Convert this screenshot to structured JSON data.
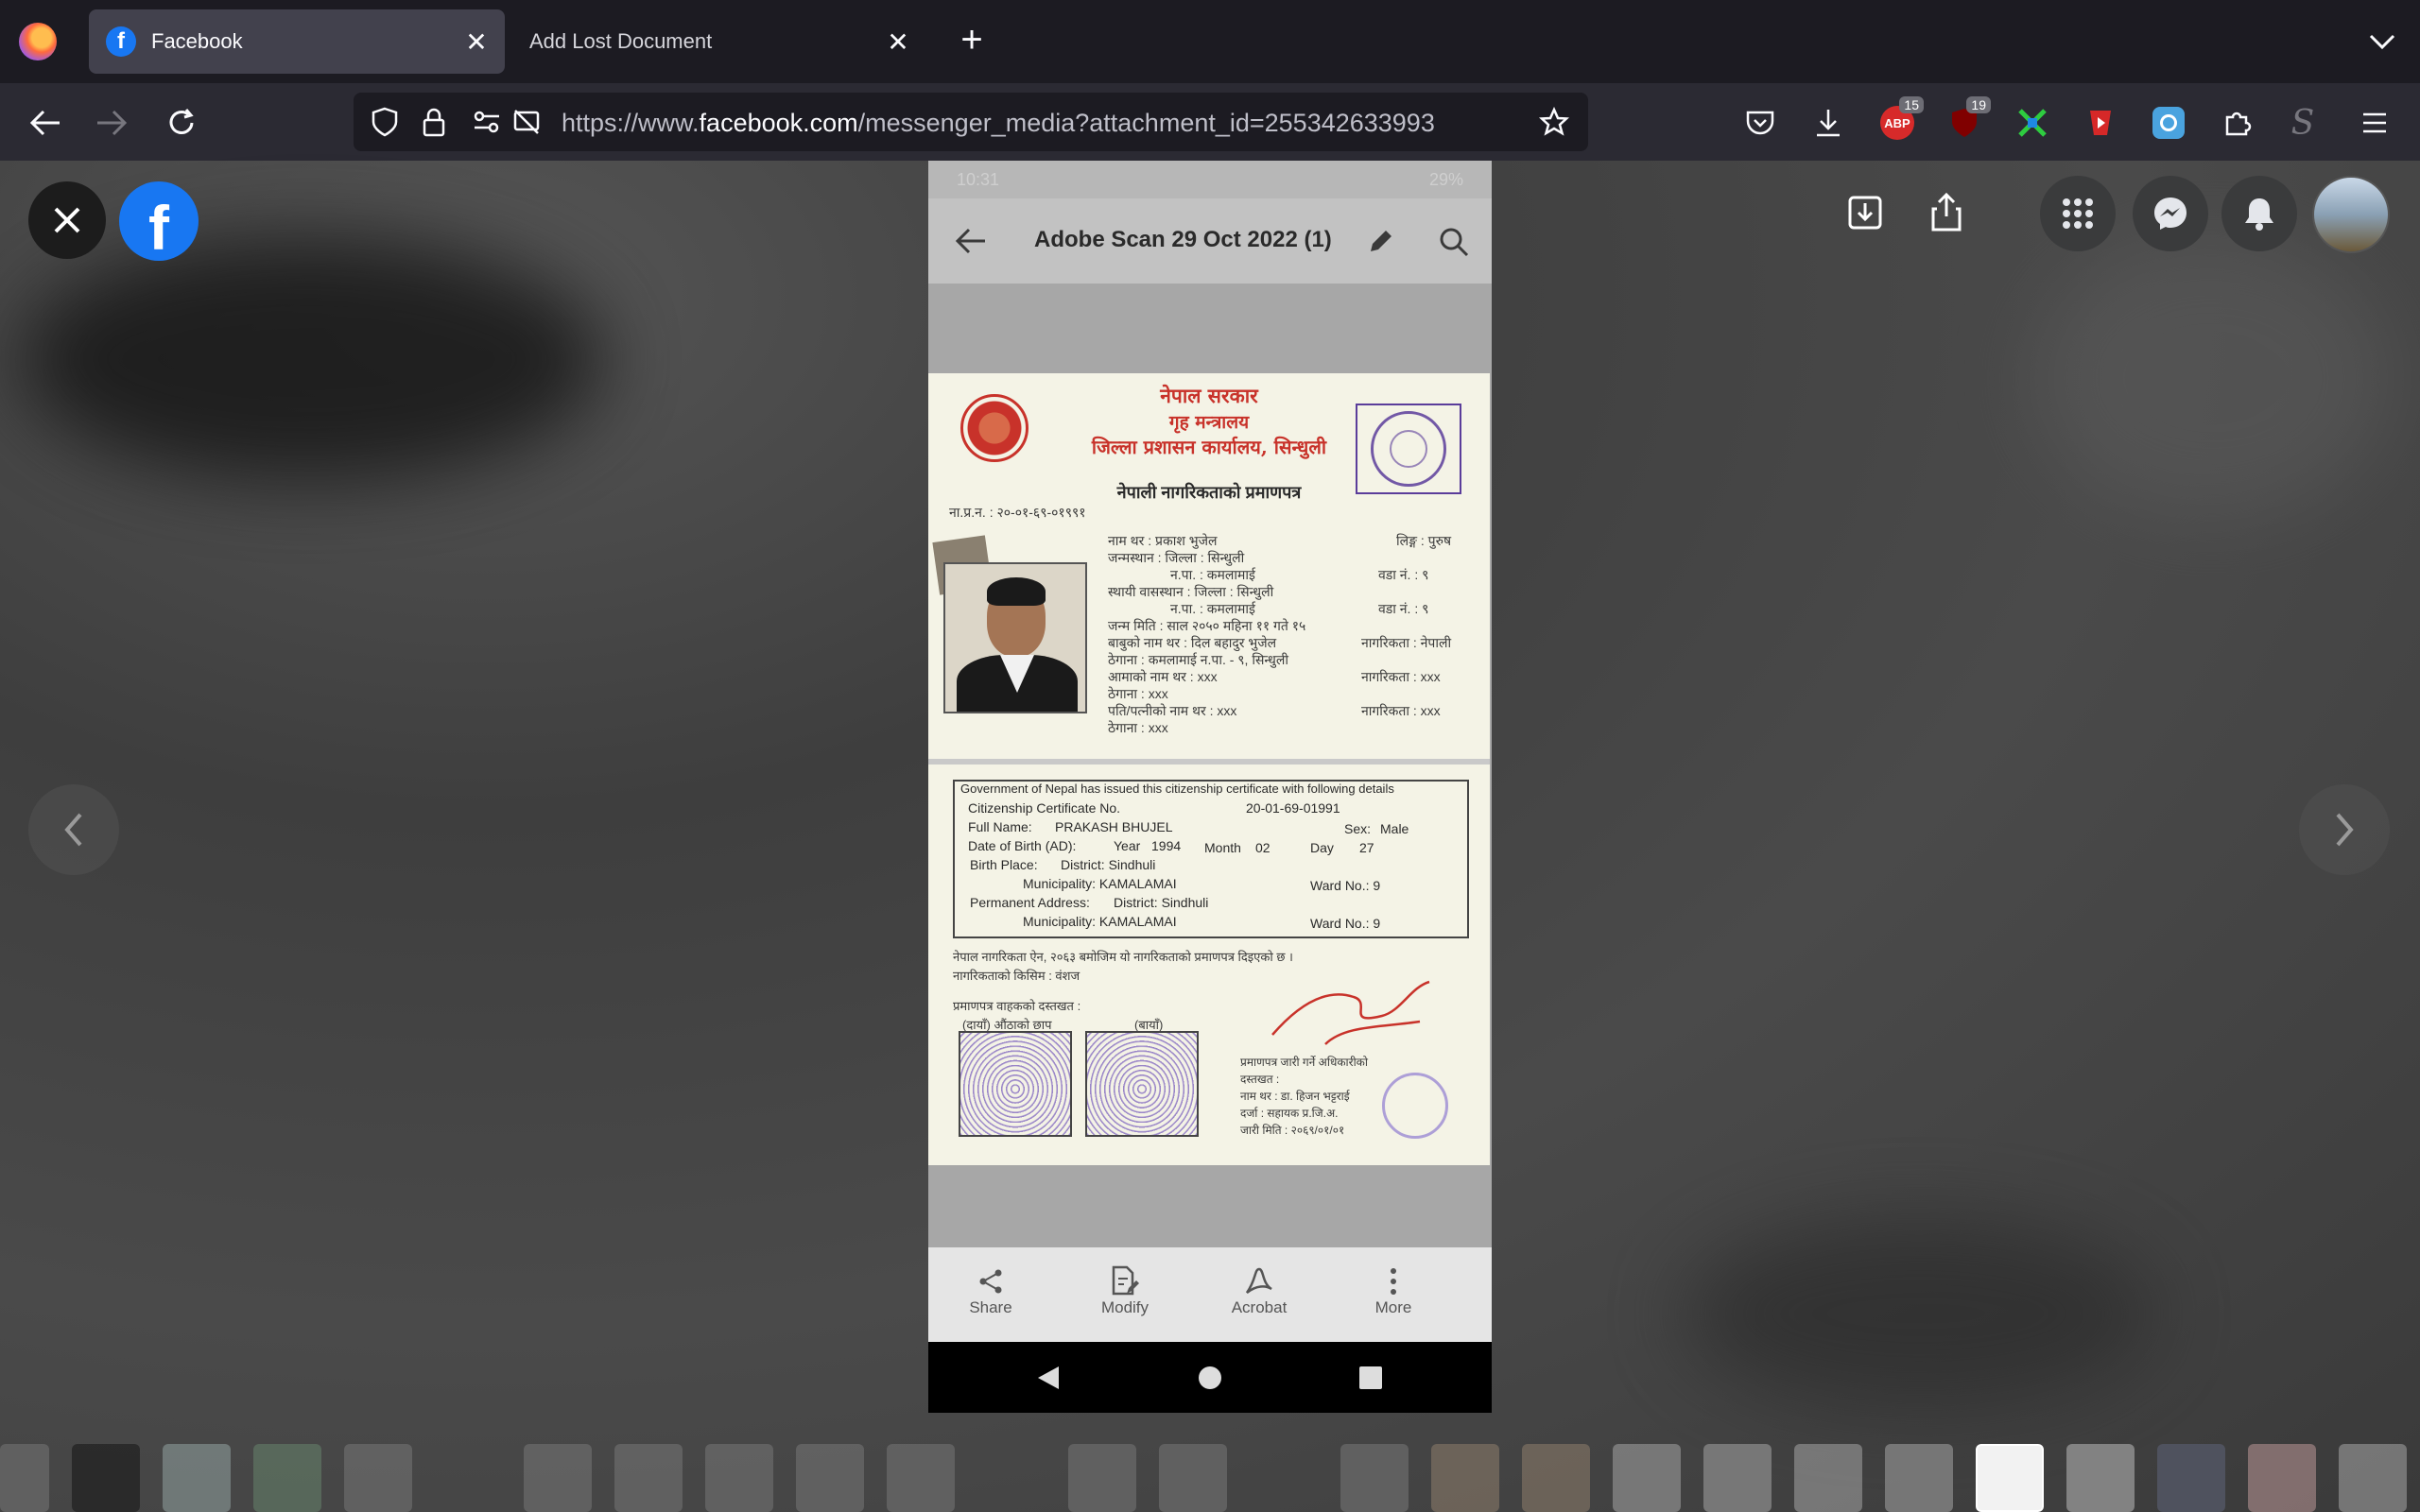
{
  "browser": {
    "tabs": [
      {
        "title": "Facebook",
        "active": true
      },
      {
        "title": "Add Lost Document",
        "active": false
      }
    ],
    "url": {
      "prefix": "https://www.",
      "domain": "facebook.com",
      "path": "/messenger_media?attachment_id=255342633993"
    },
    "extensions": [
      {
        "name": "adblock-icon",
        "badge": "15"
      },
      {
        "name": "ublock-icon",
        "badge": "19"
      }
    ]
  },
  "viewer": {
    "app": {
      "status_time": "10:31",
      "status_battery": "29%",
      "title": "Adobe Scan 29 Oct 2022 (1)",
      "bottom_actions": [
        {
          "label": "Share",
          "icon": "share-icon"
        },
        {
          "label": "Modify",
          "icon": "modify-icon"
        },
        {
          "label": "Acrobat",
          "icon": "acrobat-icon"
        },
        {
          "label": "More",
          "icon": "more-icon"
        }
      ]
    },
    "certificate": {
      "header": [
        "नेपाल सरकार",
        "गृह मन्त्रालय",
        "जिल्ला प्रशासन कार्यालय, सिन्धुली"
      ],
      "doc_title": "नेपाली नागरिकताको प्रमाणपत्र",
      "number_label": "ना.प्र.न. :",
      "number": "२०-०१-६९-०१९९१",
      "sex_np": "लिङ्ग : पुरुष",
      "nepali_lines": [
        "नाम थर : प्रकाश भुजेल",
        "जन्मस्थान : जिल्ला : सिन्धुली",
        "न.पा. : कमलामाई",
        "स्थायी वासस्थान : जिल्ला : सिन्धुली",
        "न.पा. : कमलामाई",
        "जन्म मिति : साल २०५० महिना ११ गते १५",
        "बाबुको नाम थर : दिल बहादुर भुजेल",
        "ठेगाना : कमलामाई न.पा. - ९, सिन्धुली",
        "आमाको नाम थर : xxx",
        "ठेगाना : xxx",
        "पति/पत्नीको नाम थर : xxx",
        "ठेगाना : xxx"
      ],
      "right_np": [
        "वडा नं. : ९",
        "वडा नं. : ९",
        "नागरिकता : नेपाली",
        "नागरिकता : xxx",
        "नागरिकता : xxx"
      ],
      "english": {
        "intro": "Government of Nepal has issued this citizenship certificate with following details",
        "cert_no_label": "Citizenship Certificate No.",
        "cert_no": "20-01-69-01991",
        "full_name_label": "Full Name:",
        "full_name": "PRAKASH BHUJEL",
        "sex_label": "Sex:",
        "sex": "Male",
        "dob_label": "Date of Birth (AD):",
        "dob_year_label": "Year",
        "dob_year": "1994",
        "dob_month_label": "Month",
        "dob_month": "02",
        "dob_day_label": "Day",
        "dob_day": "27",
        "birth_place_label": "Birth Place:",
        "district_label": "District:",
        "district": "Sindhuli",
        "municipality_label": "Municipality:",
        "municipality": "KAMALAMAI",
        "ward_label": "Ward No.:",
        "ward": "9",
        "permanent_label": "Permanent Address:"
      },
      "footer_np": [
        "नेपाल नागरिकता ऐन, २०६३ बमोजिम यो नागरिकताको प्रमाणपत्र दिइएको छ ।",
        "नागरिकताको किसिम : वंशज",
        "प्रमाणपत्र वाहकको दस्तखत :",
        "(दायाँ) औंठाको छाप",
        "(बायाँ)"
      ],
      "officer_np": [
        "प्रमाणपत्र जारी गर्ने अधिकारीको",
        "दस्तखत :",
        "नाम थर : डा. हिजन भट्टराई",
        "दर्जा : सहायक प्र.जि.अ.",
        "जारी मिति : २०६९/०१/०१"
      ]
    }
  },
  "colors": {
    "browser_bg": "#1c1b22",
    "toolbar_bg": "#2b2a33",
    "facebook_blue": "#1877f2",
    "stamp_purple": "#5a3c9a",
    "nepali_red": "#c8322a"
  }
}
